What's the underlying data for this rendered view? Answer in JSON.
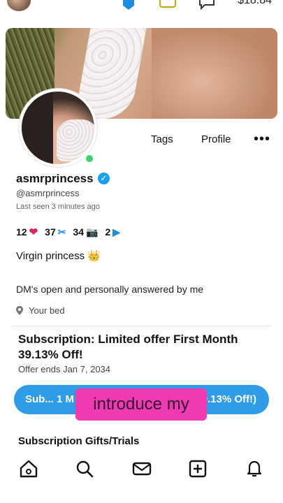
{
  "header": {
    "balance": "$18.84"
  },
  "tabs": {
    "tags": "Tags",
    "profile": "Profile",
    "more": "•••"
  },
  "profile": {
    "display_name": "asmrprincess",
    "handle": "@asmrprincess",
    "last_seen": "Last seen 3 minutes ago",
    "stats": {
      "likes": "12",
      "videos_count": "37",
      "photos": "34",
      "videos": "2"
    },
    "bio_line1": "Virgin princess 👑",
    "bio_line2": "DM's open and personally answered by me",
    "location": "Your bed"
  },
  "subscription": {
    "title": "Subscription: Limited offer First Month 39.13% Off!",
    "offer_ends": "Offer ends Jan 7, 2034",
    "button_left": "Sub... 1 M",
    "button_right": "9.13% Off!)"
  },
  "overlay_text": "introduce my",
  "gifts_title": "Subscription Gifts/Trials",
  "colors": {
    "accent": "#2f9ce8",
    "overlay": "#f03ab4",
    "heart": "#e0245e",
    "verified": "#19a0f0"
  },
  "icons": [
    "home-icon",
    "search-icon",
    "messages-icon",
    "add-post-icon",
    "notifications-icon"
  ]
}
